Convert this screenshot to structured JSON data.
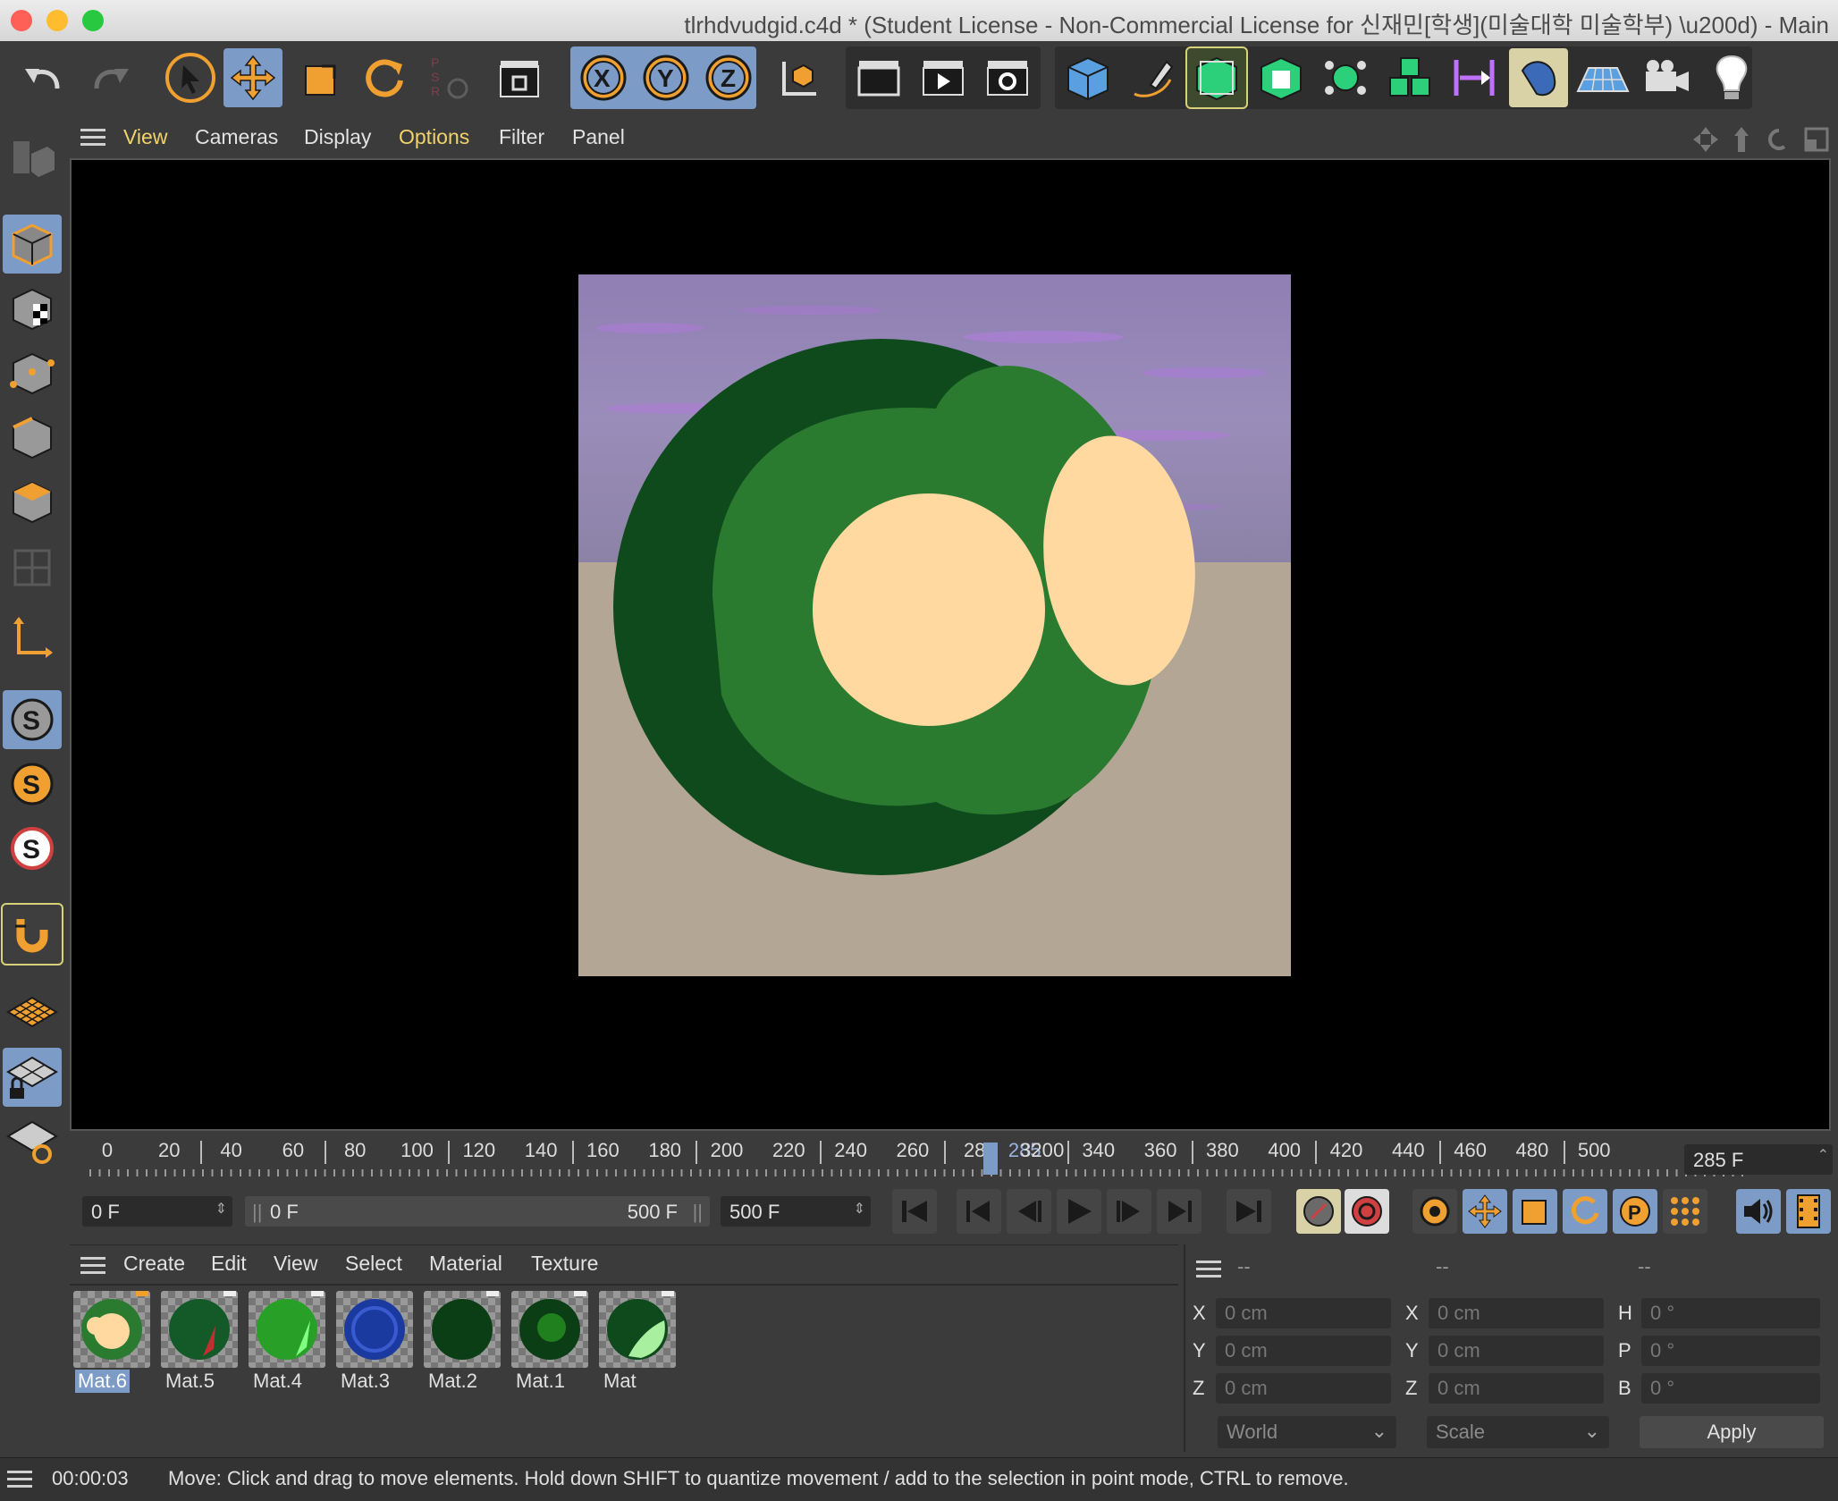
{
  "window": {
    "title": "tlrhdvudgid.c4d * (Student License - Non-Commercial License for 신재민[학생](미술대학 미술학부) \\u200d) - Main"
  },
  "viewport_menu": {
    "items": [
      "View",
      "Cameras",
      "Display",
      "Options",
      "Filter",
      "Panel"
    ]
  },
  "timeline": {
    "ticks": [
      "0",
      "20",
      "40",
      "60",
      "80",
      "100",
      "120",
      "140",
      "160",
      "180",
      "200",
      "220",
      "240",
      "260",
      "28",
      "285",
      "0",
      "320",
      "340",
      "360",
      "380",
      "400",
      "420",
      "440",
      "460",
      "480",
      "500"
    ],
    "current_frame": "285 F"
  },
  "transport": {
    "start_field": "0 F",
    "range_start": "0 F",
    "range_end": "500 F",
    "end_field": "500 F"
  },
  "material_menu": {
    "items": [
      "Create",
      "Edit",
      "View",
      "Select",
      "Material",
      "Texture"
    ]
  },
  "materials": [
    {
      "name": "Mat.6",
      "selected": true
    },
    {
      "name": "Mat.5",
      "selected": false
    },
    {
      "name": "Mat.4",
      "selected": false
    },
    {
      "name": "Mat.3",
      "selected": false
    },
    {
      "name": "Mat.2",
      "selected": false
    },
    {
      "name": "Mat.1",
      "selected": false
    },
    {
      "name": "Mat",
      "selected": false
    }
  ],
  "coordinates": {
    "headers": [
      "--",
      "--",
      "--"
    ],
    "col1": {
      "labels": [
        "X",
        "Y",
        "Z"
      ],
      "values": [
        "0 cm",
        "0 cm",
        "0 cm"
      ]
    },
    "col2": {
      "labels": [
        "X",
        "Y",
        "Z"
      ],
      "values": [
        "0 cm",
        "0 cm",
        "0 cm"
      ]
    },
    "col3": {
      "labels": [
        "H",
        "P",
        "B"
      ],
      "values": [
        "0 °",
        "0 °",
        "0 °"
      ]
    },
    "mode_dropdown": "World",
    "type_dropdown": "Scale",
    "apply_label": "Apply"
  },
  "status": {
    "time": "00:00:03",
    "message": "Move: Click and drag to move elements. Hold down SHIFT to quantize movement / add to the selection in point mode, CTRL to remove."
  },
  "colors": {
    "accent_orange": "#f0a030",
    "selection_blue": "#7c9bc7",
    "menu_highlight": "#f2d36b",
    "sphere_dark": "#0f4a1c",
    "sphere_mid": "#2a7a30",
    "eye": "#ffd9a0",
    "floor": "#b3a694",
    "sky": "#9a88b8"
  }
}
